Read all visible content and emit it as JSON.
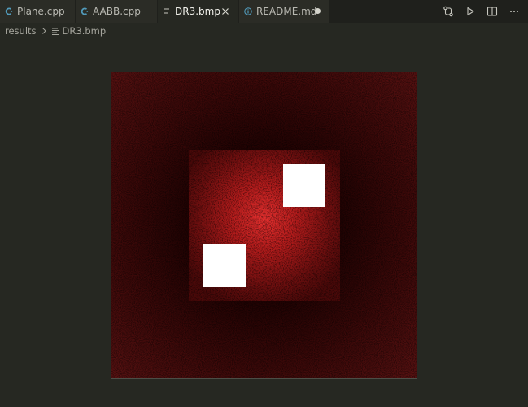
{
  "tabs": [
    {
      "label": "Plane.cpp",
      "icon": "cpp-file-icon",
      "active": false,
      "modified": false
    },
    {
      "label": "AABB.cpp",
      "icon": "cpp-file-icon",
      "active": false,
      "modified": false
    },
    {
      "label": "DR3.bmp",
      "icon": "image-file-icon",
      "active": true,
      "modified": false
    },
    {
      "label": "README.md",
      "icon": "info-icon",
      "active": false,
      "modified": true
    }
  ],
  "actions": [
    {
      "icon": "source-control-compare-icon"
    },
    {
      "icon": "run-icon"
    },
    {
      "icon": "split-editor-icon"
    },
    {
      "icon": "more-actions-icon"
    }
  ],
  "breadcrumb": {
    "folder": "results",
    "file": "DR3.bmp"
  },
  "colors": {
    "editor_background": "#262822",
    "tab_background": "#2b2c26",
    "cpp_icon": "#519aba",
    "info_icon": "#519aba",
    "render_red": "#e02a2a",
    "render_dark": "#3a0a0a",
    "light_panel": "#ffffff"
  }
}
